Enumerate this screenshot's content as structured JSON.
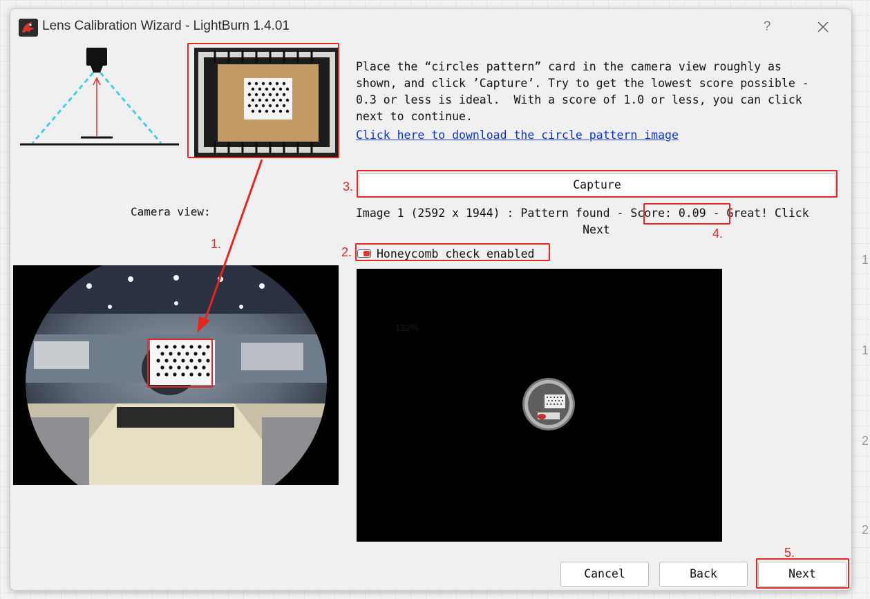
{
  "window": {
    "title": "Lens Calibration Wizard - LightBurn 1.4.01",
    "help_label": "?"
  },
  "background": {
    "edge_numbers": [
      "1",
      "1",
      "2",
      "2"
    ]
  },
  "left_panel": {
    "camera_view_label": "Camera view:"
  },
  "right_panel": {
    "instructions": "Place the “circles pattern” card in the camera view roughly as\nshown, and click ’Capture’. Try to get the lowest score possible -\n0.3 or less is ideal.  With a score of 1.0 or less, you can click\nnext to continue.",
    "download_link": "Click here to download the circle pattern image",
    "capture_label": "Capture",
    "status_prefix": "Image 1 (2592 x 1944) : Pattern found - ",
    "score_text": "Score: 0.09",
    "status_suffix": " - Great! Click",
    "status_line2": "Next",
    "honeycomb_label": "Honeycomb check enabled",
    "honeycomb_enabled": true,
    "preview_zoom": "132%"
  },
  "footer": {
    "cancel_label": "Cancel",
    "back_label": "Back",
    "next_label": "Next"
  },
  "annotations": {
    "labels": [
      "1.",
      "2.",
      "3.",
      "4.",
      "5."
    ],
    "color": "#e8251f"
  },
  "colors": {
    "window_bg": "#f0f0f0",
    "link": "#0a2fe0",
    "annotation": "#e8251f",
    "diagram_beam": "#3fd0e8",
    "diagram_axis": "#e03030"
  }
}
